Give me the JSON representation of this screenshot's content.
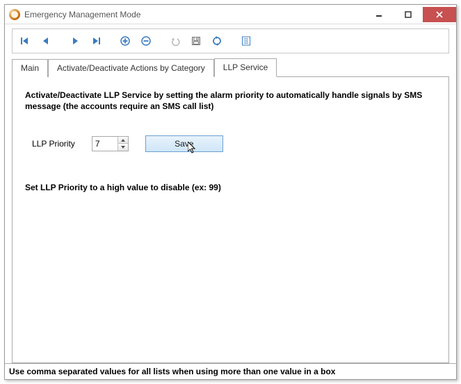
{
  "window": {
    "title": "Emergency Management Mode"
  },
  "toolbar": {
    "first_icon": "first-record",
    "prev_icon": "previous-record",
    "next_icon": "next-record",
    "last_icon": "last-record",
    "add_icon": "add",
    "remove_icon": "remove",
    "undo_icon": "undo",
    "save_icon": "save",
    "refresh_icon": "refresh",
    "list_icon": "list"
  },
  "tabs": {
    "items": [
      {
        "label": "Main",
        "active": false
      },
      {
        "label": "Activate/Deactivate Actions by Category",
        "active": false
      },
      {
        "label": "LLP Service",
        "active": true
      }
    ]
  },
  "content": {
    "instructions": "Activate/Deactivate LLP Service by setting the alarm priority to automatically handle signals by SMS message (the accounts require an SMS call list)",
    "priority_label": "LLP Priority",
    "priority_value": "7",
    "save_label": "Save",
    "hint": "Set LLP Priority to a high value to disable (ex: 99)"
  },
  "status": {
    "text": "Use comma separated values for all lists when using more than one value in a box"
  },
  "colors": {
    "accent_blue": "#3a7bbf",
    "close_red": "#c75050"
  }
}
